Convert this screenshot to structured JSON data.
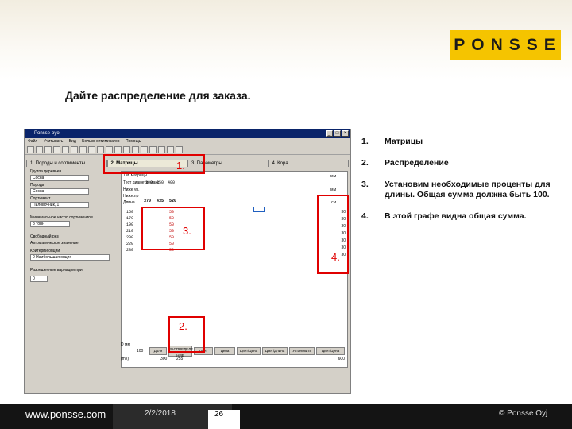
{
  "logo_text": "PONSSE",
  "title": "Дайте распределение для заказа.",
  "window": {
    "title": "Ponsse-oyo",
    "menu": [
      "Файл",
      "Учитывать",
      "Вид",
      "Болько оптимизатор",
      "Помощь"
    ],
    "tabs": [
      "1. Породы и сортименты",
      "2. Матрицы",
      "3. Параметры",
      "4. Кора"
    ],
    "left_fields": [
      {
        "label": "Группа деревьев",
        "value": "Сосна"
      },
      {
        "label": "Порода",
        "value": "Сосна"
      },
      {
        "label": "Сортимент",
        "value": "Пиловочник, 1"
      },
      {
        "label": "Минимальное число сортиментов",
        "value": "8 тонн"
      },
      {
        "label": "Критерии опций",
        "value": "0 Наибольшая опция"
      },
      {
        "label": "Разрешенные вариации при",
        "value": "0"
      }
    ],
    "checkboxes": [
      "Свободный рез",
      "Автоматическое значение"
    ],
    "matrix_labels": [
      "Тип матрицы",
      "Тест диаметр, макс",
      "Ниже ур.",
      "Нижн.пр",
      "Длина"
    ],
    "diameter_headers": [
      "300",
      "350",
      "400"
    ],
    "lengths": [
      "150",
      "170",
      "190",
      "210",
      "200",
      "220",
      "230"
    ],
    "header_row": [
      "370",
      "435",
      "520"
    ],
    "cell_values": [
      "50",
      "50",
      "50",
      "50",
      "50",
      "50",
      "50"
    ],
    "side_units": [
      "мм",
      "мм",
      "см"
    ],
    "sum_values": [
      "30",
      "30",
      "30",
      "30",
      "30",
      "30",
      "30"
    ],
    "bottom_buttons": [
      "Доля",
      "РАСПРЕДЕЛЕ НИЕ",
      "Цвет",
      "Цена",
      "Цвет/Цена",
      "Цвет/Длина",
      "Установить",
      "Цвет/Цена"
    ],
    "bottom_labels": [
      "D мм",
      "(mx)"
    ],
    "bottom_values": [
      "100",
      "300",
      "255",
      "600"
    ]
  },
  "callouts": [
    "1.",
    "2.",
    "3.",
    "4."
  ],
  "steps": [
    {
      "num": "1.",
      "text": "Матрицы"
    },
    {
      "num": "2.",
      "text": "Распределение"
    },
    {
      "num": "3.",
      "text": "Установим необходимые проценты для длины. Общая сумма должна быть 100."
    },
    {
      "num": "4.",
      "text": "В этой графе видна общая сумма."
    }
  ],
  "footer": {
    "site": "www.ponsse.com",
    "date": "2/2/2018",
    "page": "26",
    "copyright": "© Ponsse Oyj"
  },
  "colors": {
    "accent": "#f5c400",
    "callout": "#e00000",
    "footer": "#141414"
  }
}
